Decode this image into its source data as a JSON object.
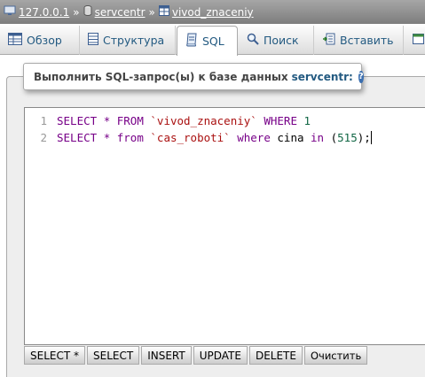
{
  "breadcrumb": {
    "server": "127.0.0.1",
    "database": "servcentr",
    "table": "vivod_znaceniy",
    "separator": "»"
  },
  "tabs": [
    {
      "label": "Обзор",
      "icon": "browse-icon"
    },
    {
      "label": "Структура",
      "icon": "structure-icon"
    },
    {
      "label": "SQL",
      "icon": "sql-icon",
      "active": true
    },
    {
      "label": "Поиск",
      "icon": "search-icon"
    },
    {
      "label": "Вставить",
      "icon": "insert-icon"
    }
  ],
  "query_panel": {
    "legend_text": "Выполнить SQL-запрос(ы) к базе данных",
    "db_name": "servcentr:"
  },
  "editor": {
    "line_numbers": [
      "1",
      "2"
    ],
    "lines": [
      "SELECT * FROM `vivod_znaceniy` WHERE 1",
      "SELECT * from `cas_roboti` where cina in (515);"
    ]
  },
  "buttons": {
    "select_star": "SELECT *",
    "select": "SELECT",
    "insert": "INSERT",
    "update": "UPDATE",
    "delete": "DELETE",
    "clear": "Очистить"
  }
}
